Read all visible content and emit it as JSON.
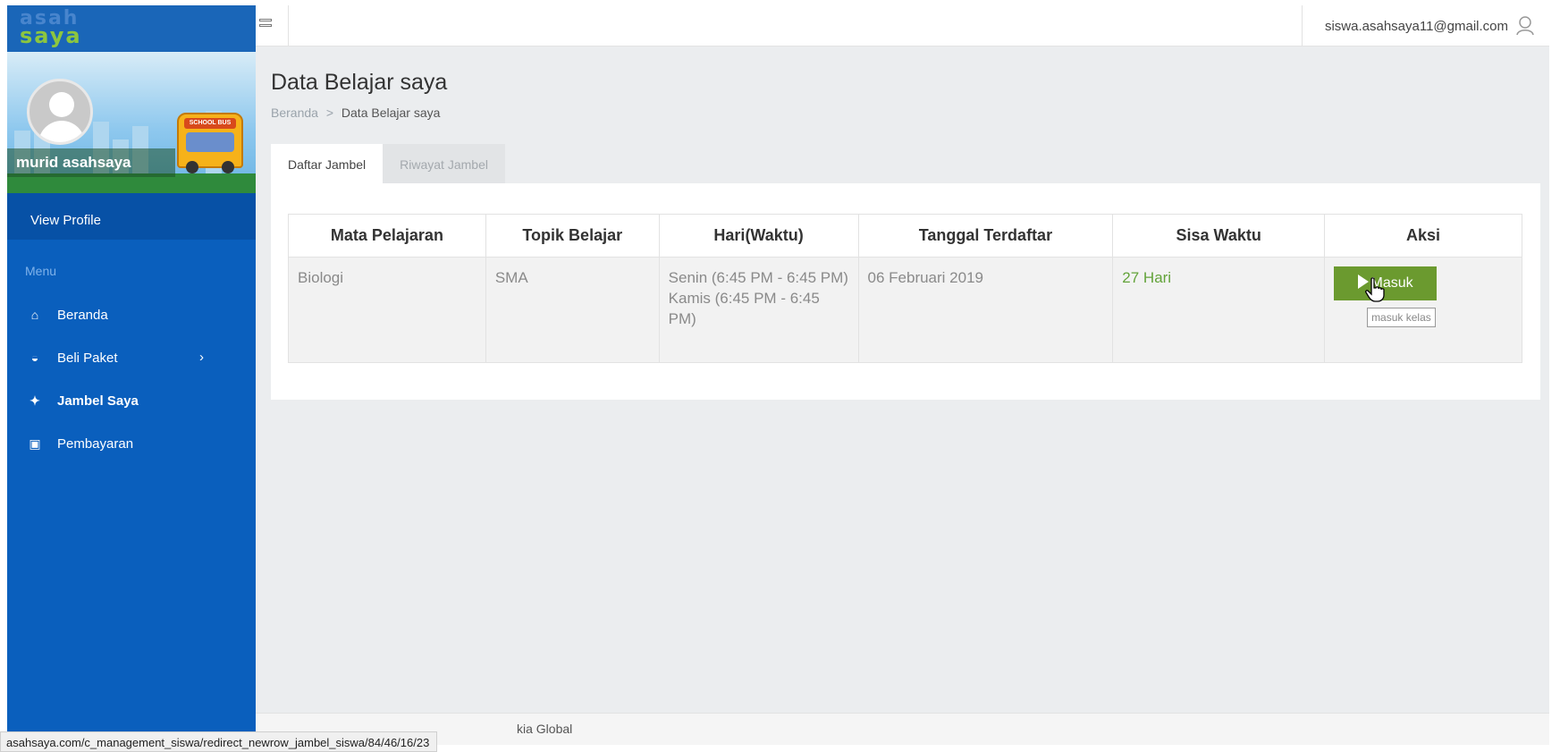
{
  "sidebar": {
    "logo_top": "asah",
    "logo_bottom": "saya",
    "profile_name": "murid asahsaya",
    "bus_sign": "SCHOOL BUS",
    "view_profile": "View Profile",
    "menu_title": "Menu",
    "items": [
      {
        "label": "Beranda",
        "icon": "home-icon",
        "glyph": "⌂"
      },
      {
        "label": "Beli Paket",
        "icon": "paket-icon",
        "glyph": "◒",
        "chevron": "›"
      },
      {
        "label": "Jambel Saya",
        "icon": "users-icon",
        "glyph": "✦",
        "active": true
      },
      {
        "label": "Pembayaran",
        "icon": "money-icon",
        "glyph": "▣"
      }
    ]
  },
  "header": {
    "user_email": "siswa.asahsaya11@gmail.com",
    "user_icon": "user-icon",
    "menu_icon": "hamburger-icon"
  },
  "main": {
    "page_title": "Data Belajar saya",
    "breadcrumb": {
      "home": "Beranda",
      "separator": ">",
      "current": "Data Belajar saya"
    },
    "tabs": [
      {
        "label": "Daftar Jambel",
        "active": true
      },
      {
        "label": "Riwayat Jambel",
        "active": false
      }
    ],
    "table": {
      "headers": [
        "Mata Pelajaran",
        "Topik Belajar",
        "Hari(Waktu)",
        "Tanggal Terdaftar",
        "Sisa Waktu",
        "Aksi"
      ],
      "rows": [
        {
          "mata_pelajaran": "Biologi",
          "topik_belajar": "SMA",
          "hari_1": "Senin (6:45 PM - 6:45 PM)",
          "hari_2": "Kamis (6:45 PM - 6:45 PM)",
          "tanggal_terdaftar": "06 Februari 2019",
          "sisa_waktu": "27 Hari",
          "aksi_label": "Masuk",
          "aksi_tooltip": "masuk kelas"
        }
      ]
    }
  },
  "footer": {
    "text": "kia Global"
  },
  "status_bar": {
    "url": "asahsaya.com/c_management_siswa/redirect_newrow_jambel_siswa/84/46/16/23"
  },
  "colors": {
    "sidebar_bg": "#0a5fbd",
    "accent_green": "#6b9a2f",
    "sisa_green": "#63a33a",
    "main_bg": "#ebedef"
  }
}
